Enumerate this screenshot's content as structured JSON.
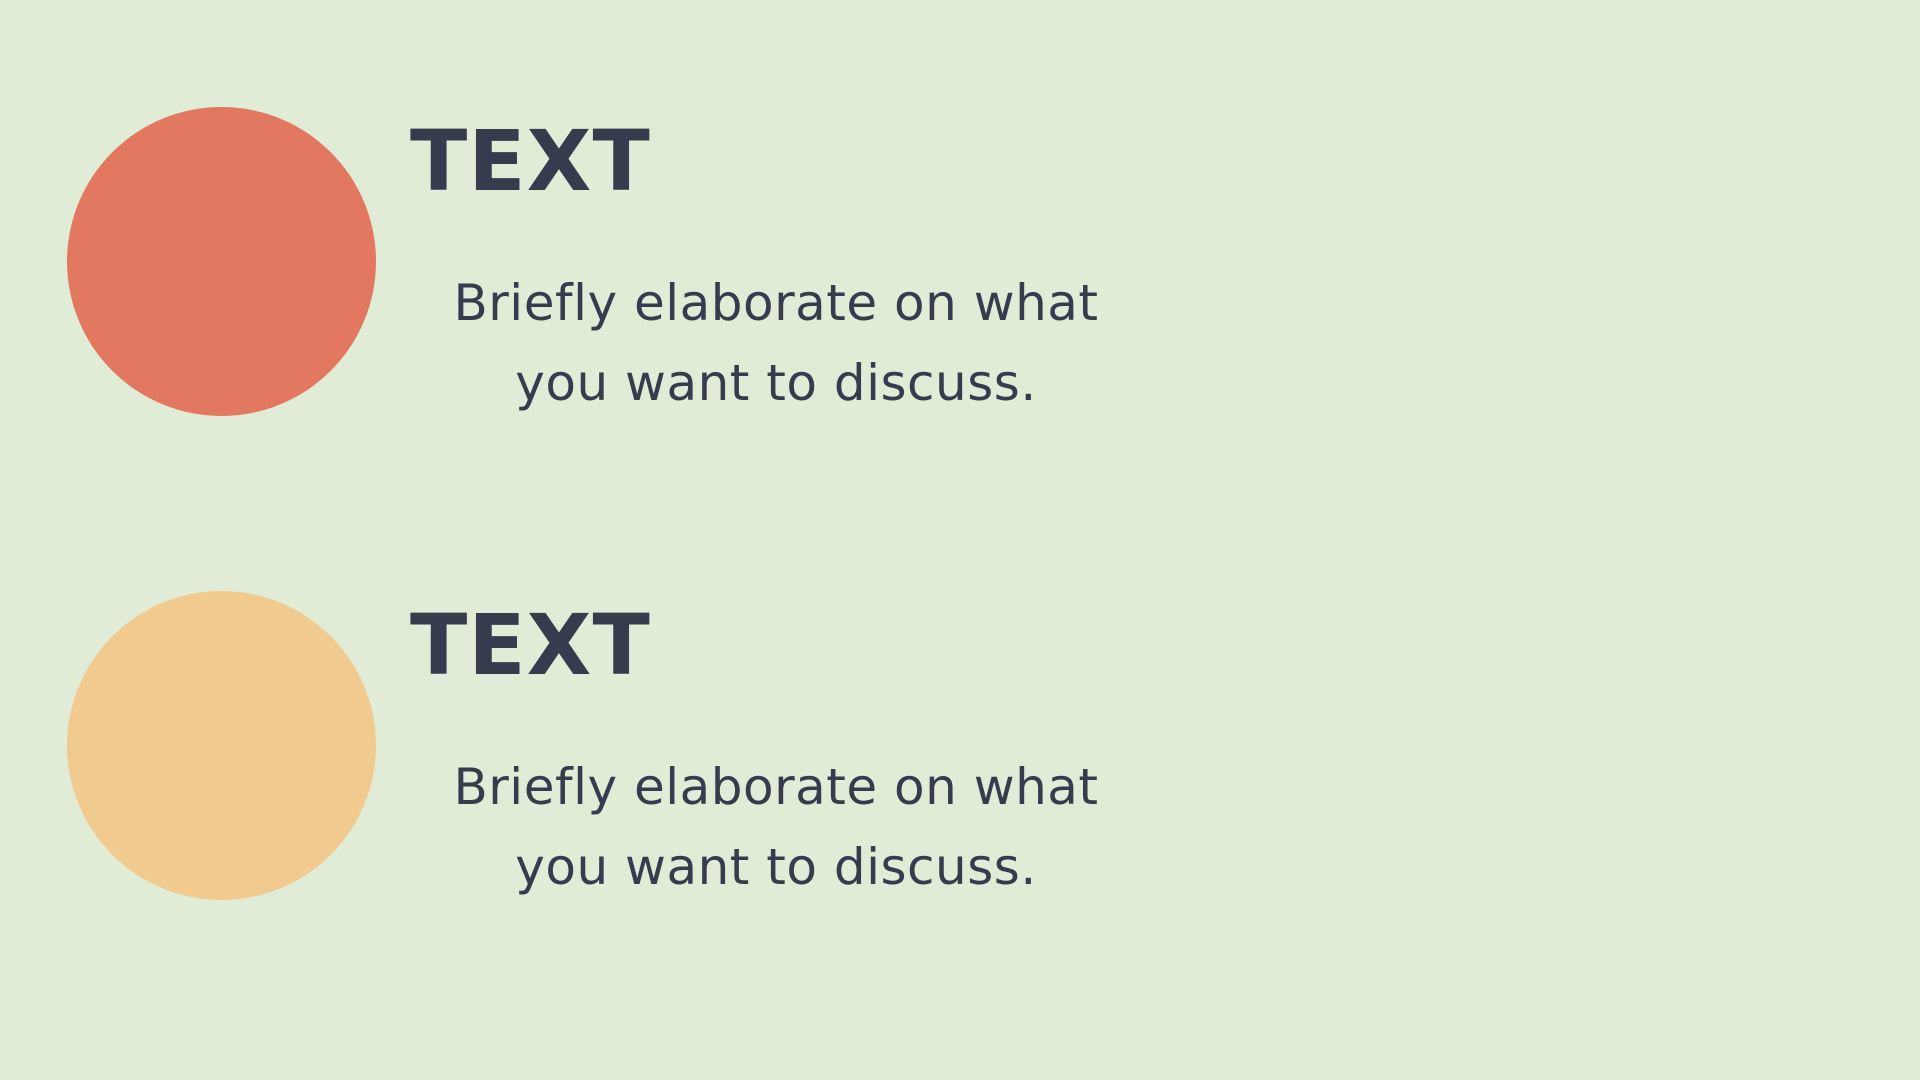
{
  "colors": {
    "background": "#E1ECD6",
    "text": "#363B4E",
    "circle_1": "#E2785F",
    "circle_2": "#F0CA8E"
  },
  "items": [
    {
      "heading": "TEXT",
      "body": "Briefly elaborate on what you want to discuss."
    },
    {
      "heading": "TEXT",
      "body": "Briefly elaborate on what you want to discuss."
    }
  ]
}
